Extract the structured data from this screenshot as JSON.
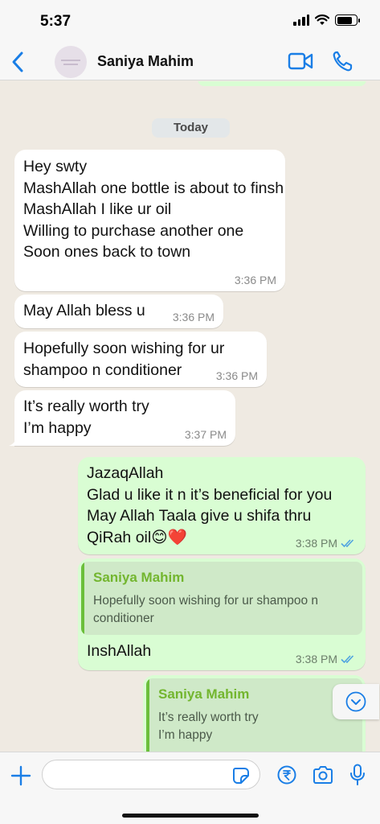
{
  "status_bar": {
    "time": "5:37",
    "battery_level": 0.8
  },
  "header": {
    "contact_name": "Saniya Mahim"
  },
  "chat": {
    "date_separator": "Today",
    "messages": [
      {
        "direction": "incoming",
        "text": "Hey swty\nMashAllah one bottle is about to finsh\nMashAllah I like ur oil\nWilling to purchase another one\nSoon ones back to town",
        "time": "3:36 PM"
      },
      {
        "direction": "incoming",
        "text": "May Allah bless u",
        "time": "3:36 PM"
      },
      {
        "direction": "incoming",
        "text": "Hopefully soon wishing for ur\nshampoo n conditioner",
        "time": "3:36 PM"
      },
      {
        "direction": "incoming",
        "text": "It’s really worth try\nI’m happy",
        "time": "3:37 PM"
      },
      {
        "direction": "outgoing",
        "text": "JazaqAllah\nGlad u like it n it’s beneficial for you\nMay Allah Taala give u shifa thru\nQiRah oil😊❤️",
        "time": "3:38 PM",
        "status": "read"
      },
      {
        "direction": "outgoing",
        "quote": {
          "author": "Saniya Mahim",
          "text": "Hopefully soon wishing for ur shampoo n\nconditioner"
        },
        "text": "InshAllah",
        "time": "3:38 PM",
        "status": "read"
      },
      {
        "direction": "outgoing",
        "quote": {
          "author": "Saniya Mahim",
          "text": "It’s really worth try\nI’m happy"
        }
      }
    ]
  },
  "composer": {
    "input_value": ""
  },
  "colors": {
    "accent": "#1a7ee6",
    "outgoing_bubble": "#d9fdd3",
    "incoming_bubble": "#ffffff",
    "chat_background": "#efeae2",
    "quote_author": "#73b62f",
    "read_ticks": "#4fa3e0"
  }
}
